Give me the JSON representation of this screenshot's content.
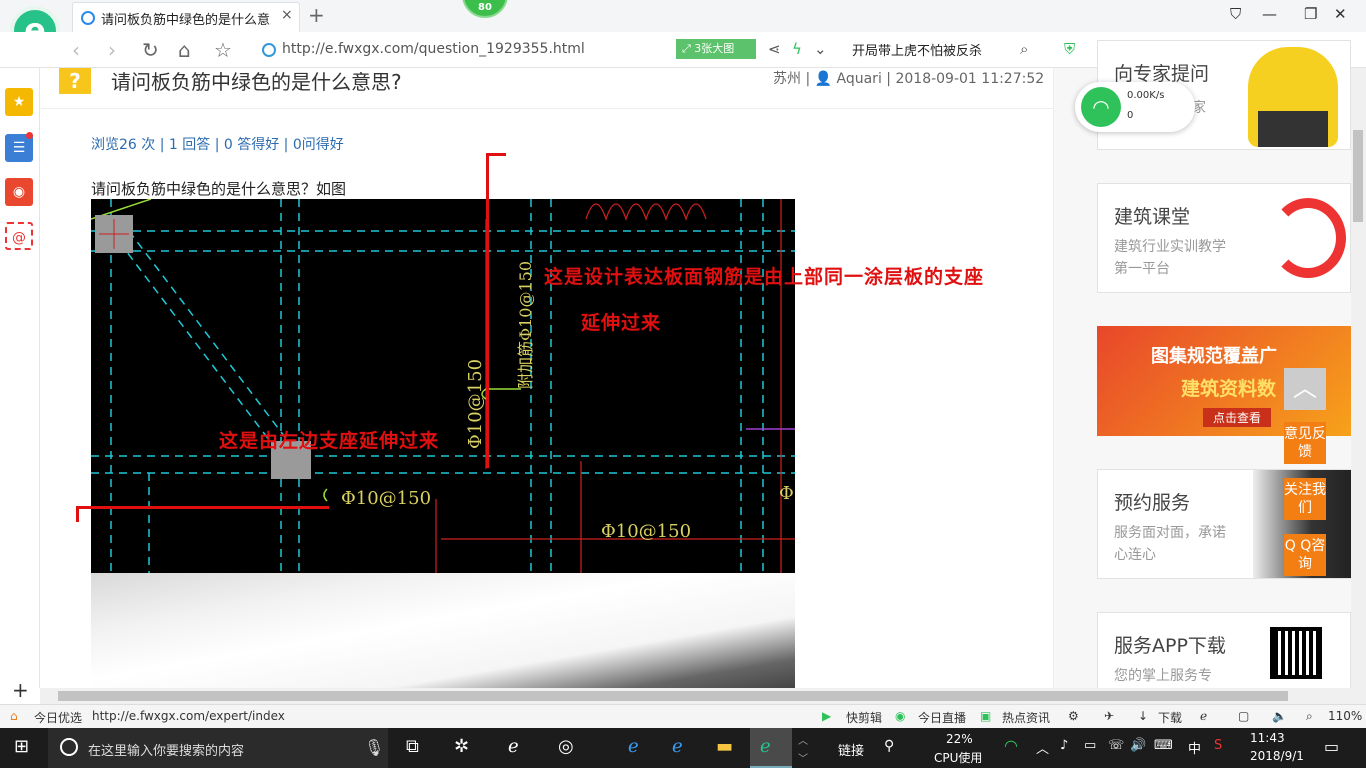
{
  "browser": {
    "tab_title": "请问板负筋中绿色的是什么意思?",
    "tab_close": "×",
    "new_tab": "+",
    "badge_count": "80",
    "address": "http://e.fwxgx.com/question_1929355.html",
    "image_button": "3张大图",
    "news_ticker": "开局带上虎不怕被反杀"
  },
  "question": {
    "icon": "?",
    "title": "请问板负筋中绿色的是什么意思?",
    "location": "苏州",
    "author": "Aquari",
    "datetime": "2018-09-01 11:27:52",
    "stats": "浏览26 次 | 1 回答 | 0 答得好 | 0问得好",
    "body": "请问板负筋中绿色的是什么意思？如图"
  },
  "drawing": {
    "annotation_top_line1": "这是设计表达板面钢筋是由上部同一涂层板的支座",
    "annotation_top_line2": "延伸过来",
    "annotation_left": "这是由左边支座延伸过来",
    "rebar_label_1": "Φ10@150",
    "rebar_label_2": "Φ10@150",
    "rebar_label_3": "Φ10@150",
    "rebar_label_4": "Φ10@150",
    "vertical_text": "附加筋Φ10@150",
    "right_partial": "Φ1"
  },
  "sidebar_right": {
    "card0_title": "向专家提问",
    "card0_sub": "专家",
    "card1_title": "建筑课堂",
    "card1_sub": "建筑行业实训教学第一平台",
    "banner_line1": "图集规范覆盖广",
    "banner_line2": "建筑资料数",
    "banner_cta": "点击查看",
    "card3_title": "预约服务",
    "card3_sub": "服务面对面，承诺心连心",
    "card4_title": "服务APP下载",
    "card4_sub": "您的掌上服务专"
  },
  "float": {
    "speed": "0.00K/s",
    "count": "0",
    "feedback": "意见反馈",
    "follow": "关注我们",
    "qq": "Q Q咨询"
  },
  "statusbar": {
    "today_pick": "今日优选",
    "status_url": "http://e.fwxgx.com/expert/index",
    "quick_edit": "快剪辑",
    "live": "今日直播",
    "hot_news": "热点资讯",
    "download": "下载",
    "zoom": "110%"
  },
  "taskbar": {
    "search_placeholder": "在这里输入你要搜索的内容",
    "links": "链接",
    "cpu_percent": "22%",
    "cpu_label": "CPU使用",
    "ime": "中",
    "time": "11:43",
    "date": "2018/9/1"
  },
  "colors": {
    "accent_green": "#27c28a",
    "annotation_red": "#e01010",
    "orange": "#f37e13",
    "cad_cyan": "#1fc8d8"
  }
}
